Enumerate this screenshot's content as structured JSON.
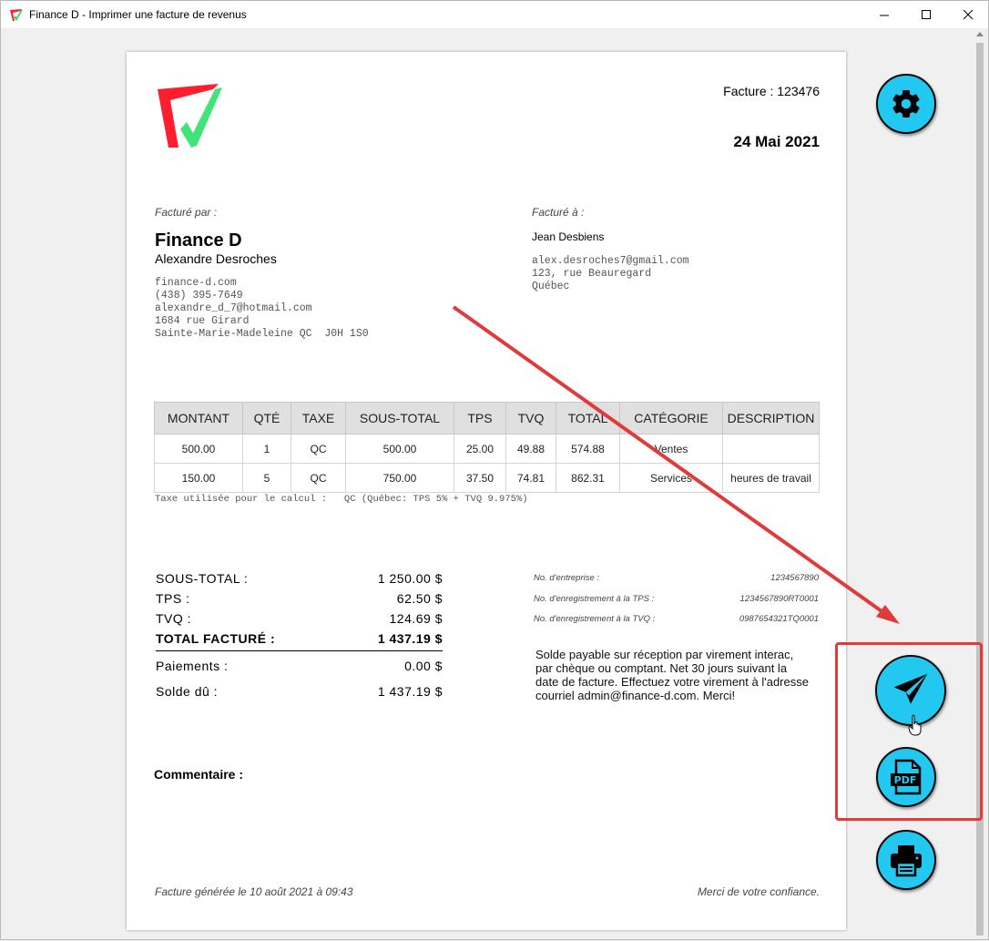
{
  "window": {
    "title": "Finance D - Imprimer une facture de revenus",
    "minimize_glyph": "—",
    "maximize_glyph": "☐",
    "close_glyph": "✕"
  },
  "invoice": {
    "number_text": "Facture : 123476",
    "date": "24 Mai 2021",
    "billed_by_label": "Facturé par :",
    "company_name": "Finance D",
    "company_person": "Alexandre Desroches",
    "company_lines": [
      "finance-d.com",
      "(438) 395-7649",
      "alexandre_d_7@hotmail.com",
      "1684 rue Girard",
      "Sainte-Marie-Madeleine QC  J0H 1S0"
    ],
    "billed_to_label": "Facturé à :",
    "client_name": "Jean Desbiens",
    "client_lines": [
      "alex.desroches7@gmail.com",
      "123, rue Beauregard",
      "Québec"
    ]
  },
  "items_table": {
    "headers": [
      "MONTANT",
      "QTÉ",
      "TAXE",
      "SOUS-TOTAL",
      "TPS",
      "TVQ",
      "TOTAL",
      "CATÉGORIE",
      "DESCRIPTION"
    ],
    "rows": [
      [
        "500.00",
        "1",
        "QC",
        "500.00",
        "25.00",
        "49.88",
        "574.88",
        "Ventes",
        ""
      ],
      [
        "150.00",
        "5",
        "QC",
        "750.00",
        "37.50",
        "74.81",
        "862.31",
        "Services",
        "heures de travail"
      ]
    ],
    "tax_note": "Taxe utilisée pour le calcul :   QC (Québec: TPS 5% + TVQ 9.975%)"
  },
  "totals": {
    "subtotal_label": "SOUS-TOTAL :",
    "subtotal_value": "1 250.00 $",
    "tps_label": "TPS :",
    "tps_value": "62.50 $",
    "tvq_label": "TVQ :",
    "tvq_value": "124.69 $",
    "total_label": "TOTAL FACTURÉ :",
    "total_value": "1 437.19 $",
    "payments_label": "Paiements :",
    "payments_value": "0.00 $",
    "balance_label": "Solde dû :",
    "balance_value": "1 437.19 $"
  },
  "registration": {
    "company_no_label": "No. d'entreprise :",
    "company_no": "1234567890",
    "tps_no_label": "No. d'enregistrement à la TPS :",
    "tps_no": "1234567890RT0001",
    "tvq_no_label": "No. d'enregistrement à la TVQ :",
    "tvq_no": "0987654321TQ0001"
  },
  "payment_note": "Solde payable sur réception par virement interac, par chèque ou comptant. Net 30 jours suivant la date de facture.  Effectuez votre virement à l'adresse courriel admin@finance-d.com. Merci!",
  "comment_label": "Commentaire :",
  "footer": {
    "generated": "Facture générée le 10 août 2021 à 09:43",
    "thanks": "Merci de votre confiance."
  },
  "actions": {
    "settings_icon": "gear-icon",
    "send_icon": "paper-plane-icon",
    "pdf_icon": "pdf-file-icon",
    "print_icon": "printer-icon"
  },
  "colors": {
    "fab_accent": "#22c8f0",
    "annotation_red": "#e03a3a",
    "logo_red": "#ff1e2d",
    "logo_green": "#2de06a"
  }
}
